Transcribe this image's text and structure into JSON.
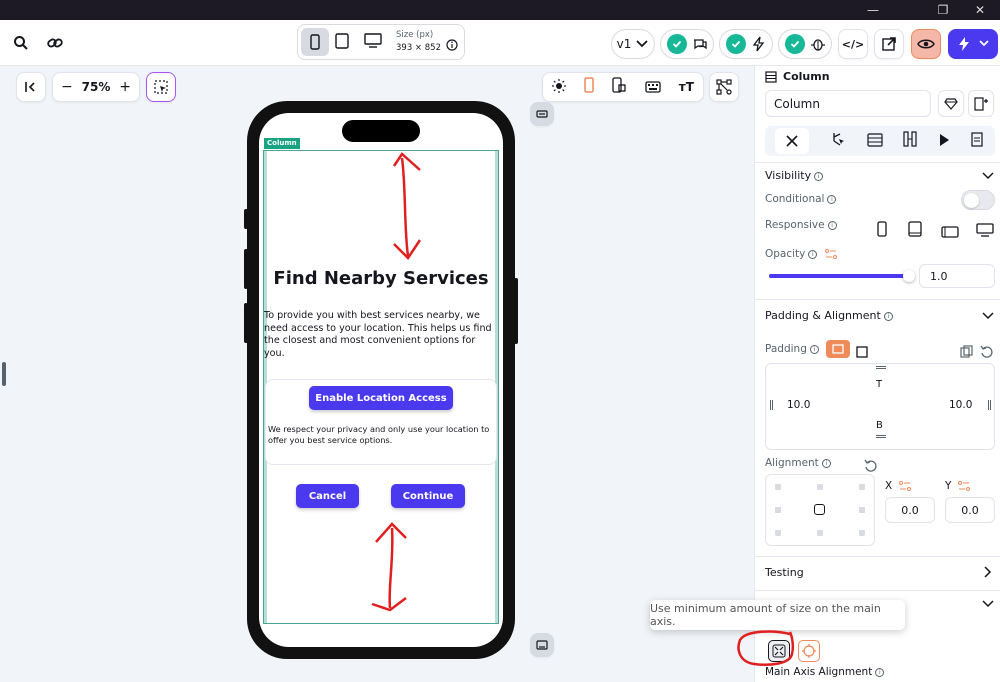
{
  "toolbar": {
    "size_label": "Size (px)",
    "size_value": "393 × 852",
    "version": "v1"
  },
  "canvas": {
    "zoom": "75%"
  },
  "phone_content": {
    "column_tag": "Column",
    "title": "Find Nearby Services",
    "description": "To provide you with best services nearby, we need access to your location. This helps us find the closest and most convenient options for you.",
    "enable_button": "Enable Location Access",
    "privacy_note": "We respect your privacy and only use your location to offer you best service options.",
    "cancel_button": "Cancel",
    "continue_button": "Continue"
  },
  "panel": {
    "widget_type": "Column",
    "widget_name": "Column",
    "visibility": {
      "title": "Visibility",
      "conditional": "Conditional",
      "responsive": "Responsive",
      "opacity": "Opacity",
      "opacity_value": "1.0",
      "opacity_level": 1.0
    },
    "padding_alignment": {
      "title": "Padding & Alignment",
      "padding": "Padding",
      "top": "T",
      "bottom": "B",
      "left_value": "10.0",
      "right_value": "10.0",
      "alignment": "Alignment",
      "x_label": "X",
      "y_label": "Y",
      "x_value": "0.0",
      "y_value": "0.0"
    },
    "testing": "Testing",
    "main_axis_alignment": "Main Axis Alignment"
  },
  "tooltip": "Use minimum amount of size on the main axis.",
  "colors": {
    "accent": "#4b39ef",
    "teal": "#17b897",
    "annotation_red": "#e02020",
    "orange": "#ef8a5a"
  }
}
